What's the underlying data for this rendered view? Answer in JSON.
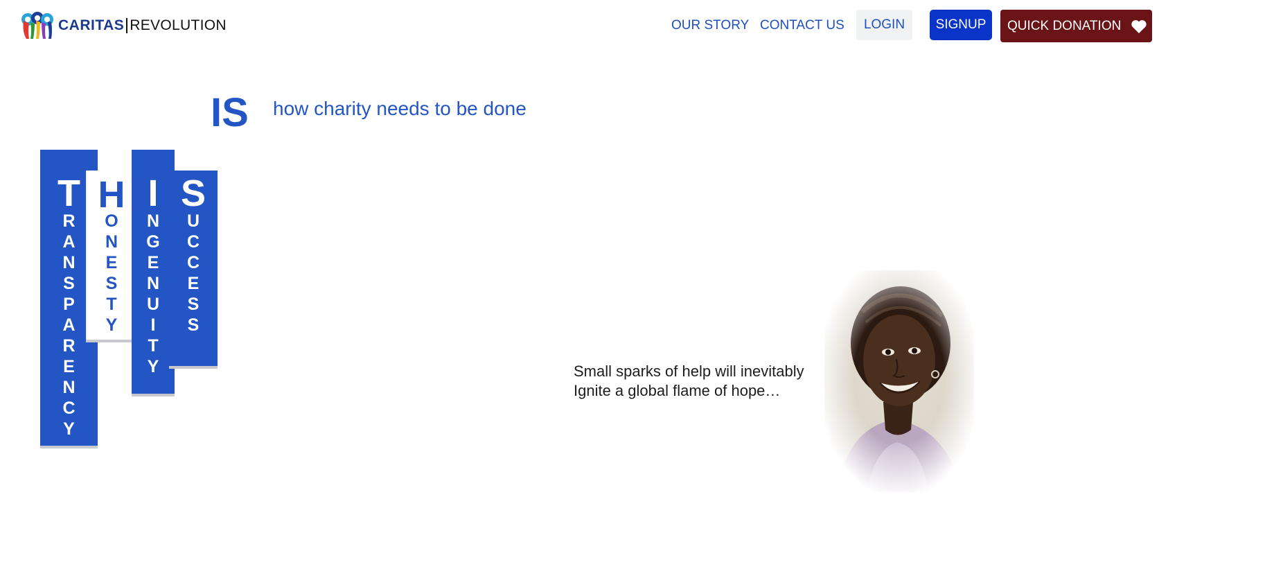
{
  "header": {
    "brand": "CARITAS",
    "brand_suffix": "REVOLUTION",
    "nav": {
      "our_story": "OUR STORY",
      "contact_us": "CONTACT US",
      "login": "LOGIN",
      "signup": "SIGNUP",
      "quick_donation": "QUICK DONATION"
    },
    "icons": {
      "logo": "caritas-logo-icon",
      "donation": "heart-icon"
    },
    "colors": {
      "nav_link": "#1e4fc0",
      "signup_bg": "#0a33c7",
      "donate_bg": "#6b1418",
      "login_bg": "#f1f2f4"
    }
  },
  "hero": {
    "is": "IS",
    "tagline": "how charity needs to be done",
    "acronym": [
      {
        "initial": "T",
        "rest": "RANSPARENCY"
      },
      {
        "initial": "H",
        "rest": "ONESTY"
      },
      {
        "initial": "I",
        "rest": "NGENUITY"
      },
      {
        "initial": "S",
        "rest": "UCCESS"
      }
    ],
    "quote_line1": "Small sparks of help will inevitably",
    "quote_line2": "Ignite a global flame of hope…",
    "accent_color": "#2355c4"
  }
}
